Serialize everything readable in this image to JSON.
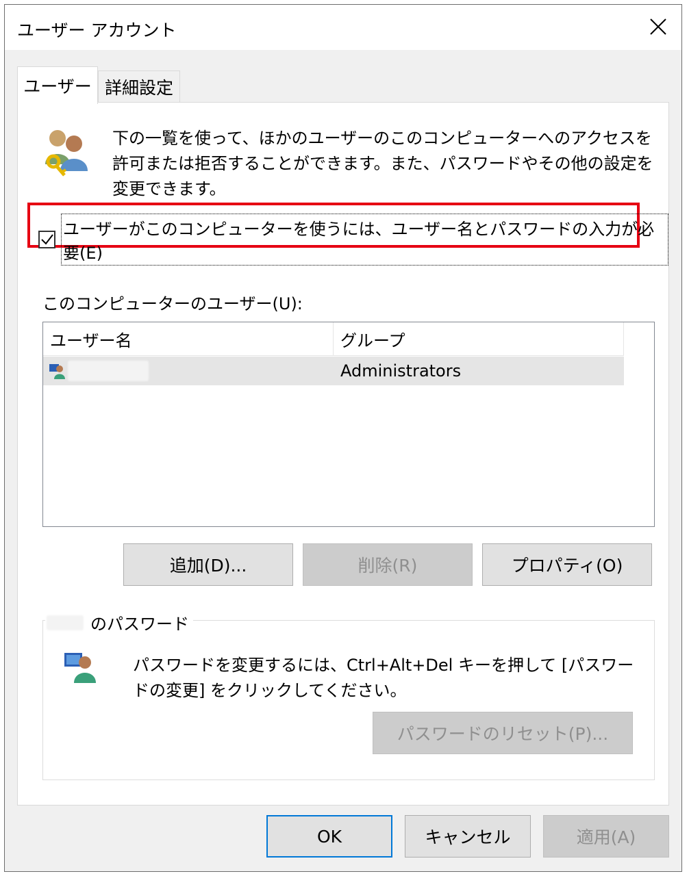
{
  "window": {
    "title": "ユーザー アカウント"
  },
  "tabs": [
    {
      "label": "ユーザー",
      "active": true
    },
    {
      "label": "詳細設定",
      "active": false
    }
  ],
  "description": "下の一覧を使って、ほかのユーザーのこのコンピューターへのアクセスを許可または拒否することができます。また、パスワードやその他の設定を変更できます。",
  "require_password": {
    "label": "ユーザーがこのコンピューターを使うには、ユーザー名とパスワードの入力が必要(E)",
    "checked": true,
    "highlight_color": "#e60012"
  },
  "users_section": {
    "label": "このコンピューターのユーザー(U):",
    "columns": [
      "ユーザー名",
      "グループ"
    ],
    "rows": [
      {
        "username": "",
        "group": "Administrators",
        "selected": true
      }
    ]
  },
  "buttons": {
    "add": "追加(D)...",
    "remove": "削除(R)",
    "properties": "プロパティ(O)"
  },
  "password_group": {
    "title_suffix": "のパスワード",
    "text": "パスワードを変更するには、Ctrl+Alt+Del キーを押して [パスワードの変更] をクリックしてください。",
    "reset_button": "パスワードのリセット(P)..."
  },
  "footer": {
    "ok": "OK",
    "cancel": "キャンセル",
    "apply": "適用(A)"
  },
  "icons": {
    "users": "users-key-icon",
    "user": "user-monitor-icon"
  },
  "colors": {
    "accent": "#0078d7",
    "dialog_bg": "#f0f0f0",
    "selected_row": "#e5e5e5"
  }
}
